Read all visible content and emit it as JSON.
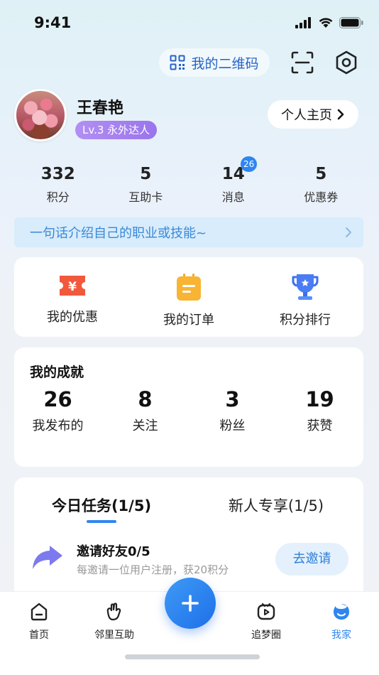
{
  "status_bar": {
    "time": "9:41"
  },
  "header": {
    "qr_label": "我的二维码"
  },
  "profile": {
    "name": "王春艳",
    "level": "Lv.3 永外达人",
    "homepage_button": "个人主页"
  },
  "stats": [
    {
      "value": "332",
      "label": "积分"
    },
    {
      "value": "5",
      "label": "互助卡"
    },
    {
      "value": "14",
      "label": "消息",
      "badge": "26"
    },
    {
      "value": "5",
      "label": "优惠券"
    }
  ],
  "intro": {
    "placeholder": "一句话介绍自己的职业或技能~"
  },
  "quick_actions": [
    {
      "label": "我的优惠",
      "icon": "coupon-icon"
    },
    {
      "label": "我的订单",
      "icon": "order-icon"
    },
    {
      "label": "积分排行",
      "icon": "trophy-icon"
    }
  ],
  "achievements": {
    "title": "我的成就",
    "items": [
      {
        "value": "26",
        "label": "我发布的"
      },
      {
        "value": "8",
        "label": "关注"
      },
      {
        "value": "3",
        "label": "粉丝"
      },
      {
        "value": "19",
        "label": "获赞"
      }
    ]
  },
  "tasks": {
    "tabs": [
      "今日任务(1/5)",
      "新人专享(1/5)"
    ],
    "item": {
      "title": "邀请好友0/5",
      "description": "每邀请一位用户注册，获20积分",
      "button": "去邀请"
    }
  },
  "bottom_nav": [
    {
      "label": "首页",
      "icon": "home-icon"
    },
    {
      "label": "邻里互助",
      "icon": "help-hand-icon"
    },
    {
      "label": "追梦圈",
      "icon": "video-circle-icon"
    },
    {
      "label": "我家",
      "icon": "profile-icon",
      "active": true
    }
  ],
  "colors": {
    "accent": "#2f86f0",
    "level_badge": "#9a74ec"
  }
}
